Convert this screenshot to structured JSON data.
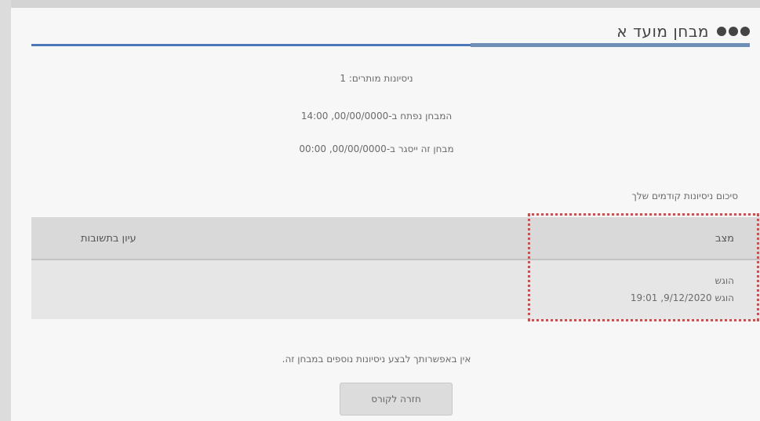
{
  "header": {
    "title": "מבחן מועד א"
  },
  "info": {
    "grading_method": "ניסיונות מותרים: 1",
    "opened": "המבחן נפתח ב-00/00/0000, 14:00",
    "closes": "מבחן זה ייסגר ב-00/00/0000, 00:00"
  },
  "summary": {
    "label": "סיכום ניסיונות קודמים שלך"
  },
  "table": {
    "headers": {
      "status": "מצב",
      "review": "עיון בתשובות"
    },
    "rows": [
      {
        "status": "הוגש",
        "submitted": "הוגש 9/12/2020, 19:01"
      }
    ]
  },
  "notice": {
    "text": "אין באפשרותך לבצע ניסיונות נוספים במבחן זה."
  },
  "actions": {
    "back_label": "חזרה לקורס"
  }
}
